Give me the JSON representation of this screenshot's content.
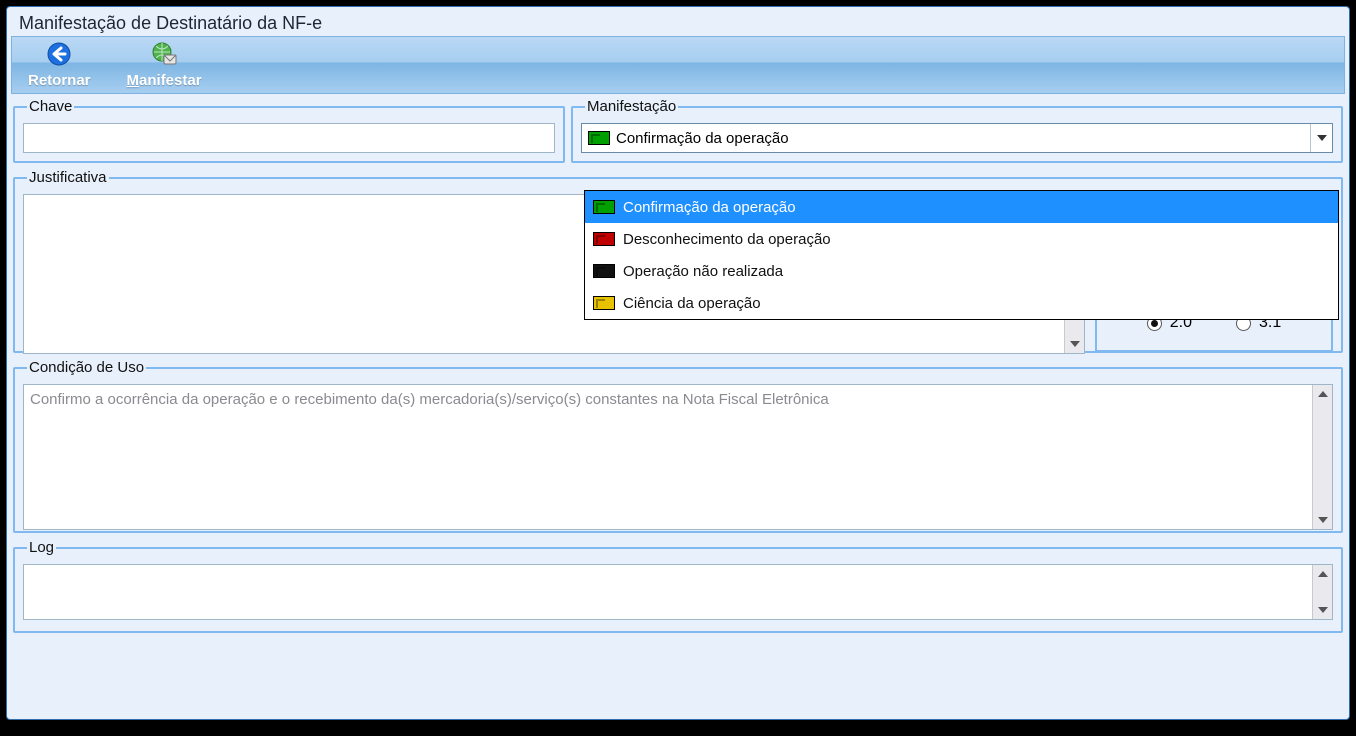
{
  "window_title": "Manifestação de Destinatário da NF-e",
  "toolbar": {
    "retornar_label": "Retornar",
    "manifestar_prefix": "M",
    "manifestar_suffix": "anifestar"
  },
  "groups": {
    "chave_label": "Chave",
    "manifestacao_label": "Manifestação",
    "justificativa_label": "Justificativa",
    "condicao_label": "Condição de Uso",
    "log_label": "Log"
  },
  "combo": {
    "selected_label": "Confirmação da operação",
    "selected_color": "green",
    "options": [
      {
        "label": "Confirmação da operação",
        "color": "green",
        "selected": true
      },
      {
        "label": "Desconhecimento da operação",
        "color": "red",
        "selected": false
      },
      {
        "label": "Operação não realizada",
        "color": "black",
        "selected": false
      },
      {
        "label": "Ciência da operação",
        "color": "yellow",
        "selected": false
      }
    ]
  },
  "version": {
    "opt1": "2.0",
    "opt2": "3.1",
    "selected": "2.0"
  },
  "condicao_text": "Confirmo a ocorrência da operação e o recebimento da(s) mercadoria(s)/serviço(s) constantes na Nota Fiscal Eletrônica",
  "chave_value": "",
  "justificativa_value": "",
  "log_value": ""
}
